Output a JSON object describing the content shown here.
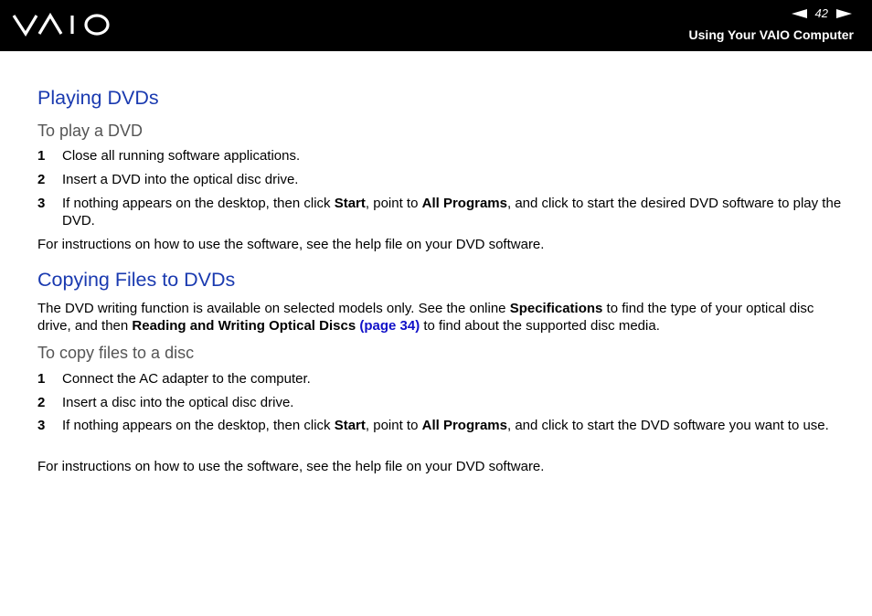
{
  "header": {
    "logo": "VAIO",
    "page_number": "42",
    "section_title": "Using Your VAIO Computer"
  },
  "section1": {
    "title": "Playing DVDs",
    "subtitle": "To play a DVD",
    "steps": [
      {
        "num": "1",
        "text": "Close all running software applications."
      },
      {
        "num": "2",
        "text": "Insert a DVD into the optical disc drive."
      },
      {
        "num": "3",
        "pre": "If nothing appears on the desktop, then click ",
        "b1": "Start",
        "mid": ", point to ",
        "b2": "All Programs",
        "post": ", and click to start the desired DVD software to play the DVD."
      }
    ],
    "note": "For instructions on how to use the software, see the help file on your DVD software."
  },
  "section2": {
    "title": "Copying Files to DVDs",
    "intro": {
      "t1": "The DVD writing function is available on selected models only. See the online ",
      "b1": "Specifications",
      "t2": " to find the type of your optical disc drive, and then ",
      "b2": "Reading and Writing Optical Discs",
      "link": "(page 34)",
      "t3": " to find about the supported disc media."
    },
    "subtitle": "To copy files to a disc",
    "steps": [
      {
        "num": "1",
        "text": "Connect the AC adapter to the computer."
      },
      {
        "num": "2",
        "text": "Insert a disc into the optical disc drive."
      },
      {
        "num": "3",
        "pre": "If nothing appears on the desktop, then click ",
        "b1": "Start",
        "mid": ", point to ",
        "b2": "All Programs",
        "post": ", and click to start the DVD software you want to use."
      }
    ],
    "note": "For instructions on how to use the software, see the help file on your DVD software."
  },
  "colors": {
    "header_bg": "#000000",
    "heading": "#1a3ab0",
    "subheading": "#555555",
    "link": "#1010c8"
  }
}
